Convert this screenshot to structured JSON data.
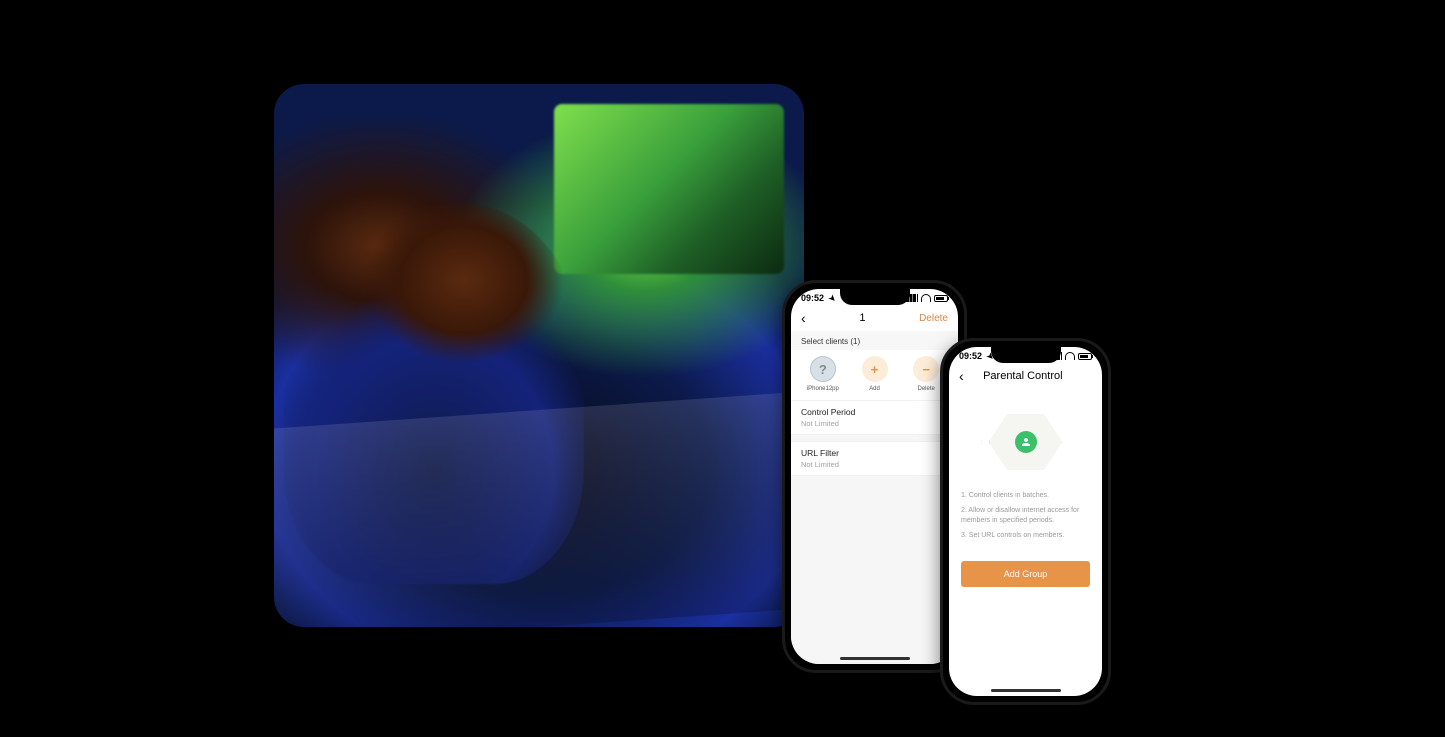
{
  "phone1": {
    "status": {
      "time": "09:52",
      "location_arrow": "➤"
    },
    "nav": {
      "title": "1",
      "delete": "Delete"
    },
    "section_label": "Select clients (1)",
    "clients": {
      "device": {
        "label": "iPhone12pp"
      },
      "add": {
        "label": "Add"
      },
      "delete": {
        "label": "Delete"
      }
    },
    "rows": {
      "control_period": {
        "title": "Control Period",
        "value": "Not Limited"
      },
      "url_filter": {
        "title": "URL Filter",
        "value": "Not Limited"
      }
    }
  },
  "phone2": {
    "status": {
      "time": "09:52",
      "location_arrow": "➤"
    },
    "nav": {
      "title": "Parental Control"
    },
    "tips": {
      "t1": "1. Control clients in batches.",
      "t2": "2. Allow or disallow internet access for members in specified periods.",
      "t3": "3. Set URL controls on members."
    },
    "cta": "Add Group"
  }
}
